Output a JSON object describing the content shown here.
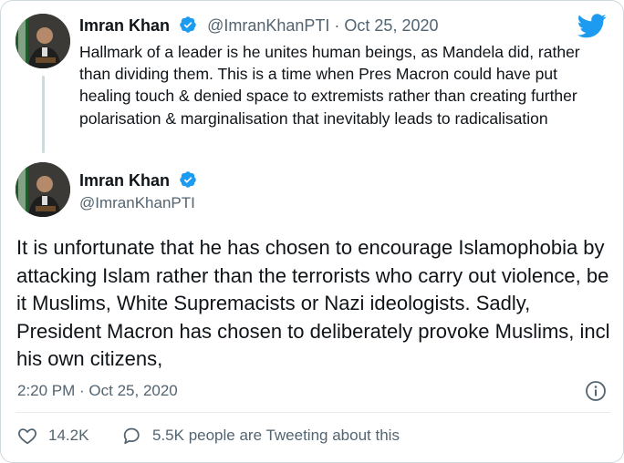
{
  "quoted_tweet": {
    "author_name": "Imran Khan",
    "handle": "@ImranKhanPTI",
    "separator": "·",
    "date": "Oct 25, 2020",
    "text": "Hallmark of a leader is he unites human beings, as Mandela did, rather than dividing them. This is a time when Pres Macron could have put healing touch & denied space to extremists rather than creating further polarisation & marginalisation that inevitably leads to radicalisation"
  },
  "main_tweet": {
    "author_name": "Imran Khan",
    "handle": "@ImranKhanPTI",
    "text": "It is unfortunate that he has chosen to encourage Islamophobia by attacking Islam rather than the terrorists who carry out violence, be it Muslims, White Supremacists or Nazi ideologists. Sadly, President Macron has chosen to deliberately provoke Muslims, incl his own citizens,",
    "timestamp": "2:20 PM · Oct 25, 2020",
    "likes": "14.2K",
    "conversation": "5.5K people are Tweeting about this"
  },
  "icons": {
    "verified": "verified-badge-icon",
    "brand": "twitter-bird-icon",
    "info": "info-icon",
    "like": "heart-icon",
    "conversation": "speech-bubble-icon"
  },
  "colors": {
    "twitter_blue": "#1d9bf0",
    "text": "#0f1419",
    "muted": "#536471",
    "border": "#cfd9de"
  }
}
